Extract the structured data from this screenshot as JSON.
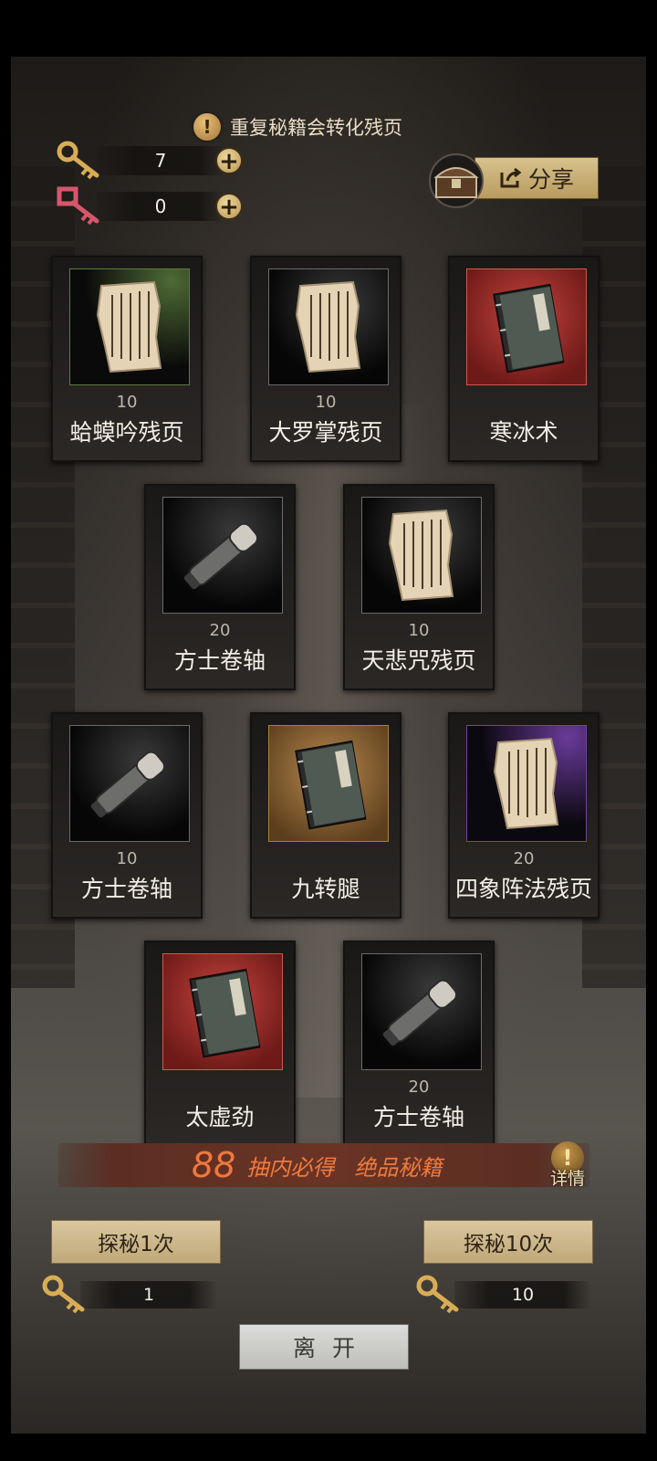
{
  "notice": {
    "icon": "warning-icon",
    "text": "重复秘籍会转化残页"
  },
  "keys": {
    "gold": {
      "icon": "gold-key-icon",
      "count": "7",
      "add_icon": "plus-icon"
    },
    "red": {
      "icon": "red-key-icon",
      "count": "0",
      "add_icon": "plus-icon"
    }
  },
  "share": {
    "chest_icon": "treasure-chest-icon",
    "icon": "share-icon",
    "label": "分享"
  },
  "items": [
    {
      "name": "蛤蟆吟残页",
      "qty": "10",
      "type": "fragment",
      "rarity": "green"
    },
    {
      "name": "大罗掌残页",
      "qty": "10",
      "type": "fragment",
      "rarity": "black"
    },
    {
      "name": "寒冰术",
      "qty": "",
      "type": "book",
      "rarity": "red"
    },
    {
      "name": "方士卷轴",
      "qty": "20",
      "type": "scroll",
      "rarity": "black"
    },
    {
      "name": "天悲咒残页",
      "qty": "10",
      "type": "fragment",
      "rarity": "black"
    },
    {
      "name": "方士卷轴",
      "qty": "10",
      "type": "scroll",
      "rarity": "black"
    },
    {
      "name": "九转腿",
      "qty": "",
      "type": "book",
      "rarity": "gold"
    },
    {
      "name": "四象阵法残页",
      "qty": "20",
      "type": "fragment",
      "rarity": "purple"
    },
    {
      "name": "太虚劲",
      "qty": "",
      "type": "book",
      "rarity": "red"
    },
    {
      "name": "方士卷轴",
      "qty": "20",
      "type": "scroll",
      "rarity": "black"
    }
  ],
  "guarantee": {
    "number": "88",
    "text1": "抽内必得",
    "text2": "绝品秘籍"
  },
  "detail": {
    "icon": "info-icon",
    "label": "详情"
  },
  "draw_one": {
    "label": "探秘1次",
    "cost": "1",
    "cost_icon": "gold-key-icon"
  },
  "draw_ten": {
    "label": "探秘10次",
    "cost": "10",
    "cost_icon": "gold-key-icon"
  },
  "leave": {
    "label": "离开"
  },
  "colors": {
    "accent": "#f0783d",
    "button_gold": "#d1bb8b",
    "frame_bg": "#3a3633"
  }
}
